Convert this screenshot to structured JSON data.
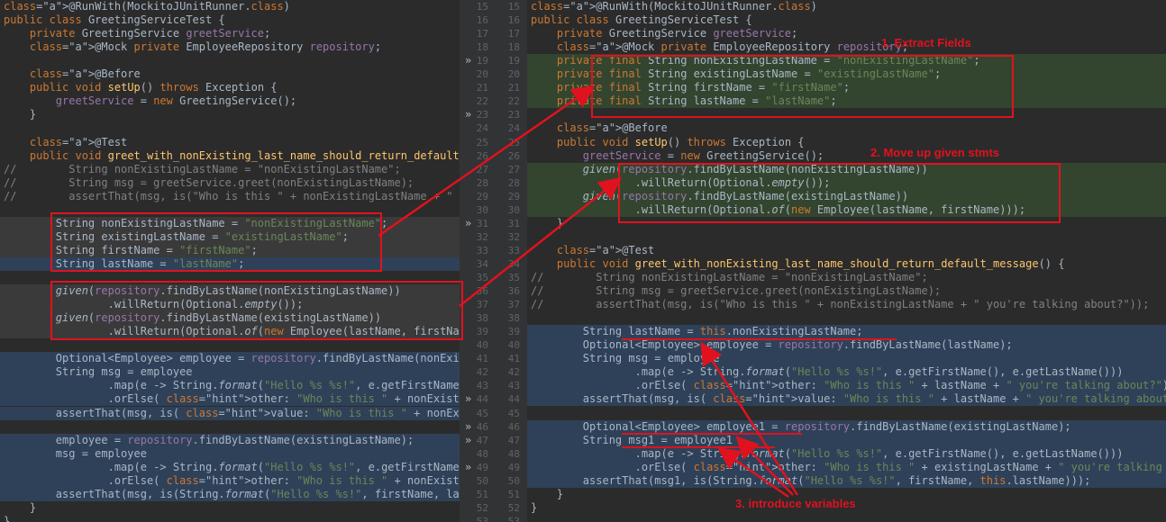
{
  "left_code": [
    "@RunWith(MockitoJUnitRunner.class)",
    "public class GreetingServiceTest {",
    "    private GreetingService greetService;",
    "    @Mock private EmployeeRepository repository;",
    "",
    "    @Before",
    "    public void setUp() throws Exception {",
    "        greetService = new GreetingService();",
    "    }",
    "",
    "    @Test",
    "    public void greet_with_nonExisting_last_name_should_return_default_m",
    "//        String nonExistingLastName = \"nonExistingLastName\";",
    "//        String msg = greetService.greet(nonExistingLastName);",
    "//        assertThat(msg, is(\"Who is this \" + nonExistingLastName + \" yo",
    "",
    "        String nonExistingLastName = \"nonExistingLastName\";",
    "        String existingLastName = \"existingLastName\";",
    "        String firstName = \"firstName\";",
    "        String lastName = \"lastName\";",
    "",
    "        given(repository.findByLastName(nonExistingLastName))",
    "                .willReturn(Optional.empty());",
    "        given(repository.findByLastName(existingLastName))",
    "                .willReturn(Optional.of(new Employee(lastName, firstName",
    "",
    "        Optional<Employee> employee = repository.findByLastName(nonExist",
    "        String msg = employee",
    "                .map(e -> String.format(\"Hello %s %s!\", e.getFirstName()",
    "                .orElse( other: \"Who is this \" + nonExistingLastName + \" y",
    "        assertThat(msg, is( value: \"Who is this \" + nonExistingLastName + \" y",
    "",
    "        employee = repository.findByLastName(existingLastName);",
    "        msg = employee",
    "                .map(e -> String.format(\"Hello %s %s!\", e.getFirstName()",
    "                .orElse( other: \"Who is this \" + nonExistingLastName + \" y",
    "        assertThat(msg, is(String.format(\"Hello %s %s!\", firstName, last",
    "    }",
    "}"
  ],
  "left_numbers": [
    "15",
    "16",
    "17",
    "18",
    "19",
    "20",
    "21",
    "22",
    "23",
    "24",
    "25",
    "26",
    "27",
    "28",
    "29",
    "30",
    "31",
    "32",
    "33",
    "34",
    "35",
    "36",
    "37",
    "38",
    "39",
    "40",
    "41",
    "42",
    "43",
    "44",
    "45",
    "46",
    "47",
    "48",
    "49",
    "50",
    "51",
    "52",
    "53"
  ],
  "right_numbers": [
    "15",
    "16",
    "17",
    "18",
    "19",
    "20",
    "21",
    "22",
    "23",
    "24",
    "25",
    "26",
    "27",
    "28",
    "29",
    "30",
    "31",
    "32",
    "33",
    "34",
    "35",
    "36",
    "37",
    "38",
    "39",
    "40",
    "41",
    "42",
    "43",
    "44",
    "45",
    "46",
    "47",
    "48",
    "49",
    "50",
    "51",
    "52",
    "53"
  ],
  "right_code": [
    "@RunWith(MockitoJUnitRunner.class)",
    "public class GreetingServiceTest {",
    "    private GreetingService greetService;",
    "    @Mock private EmployeeRepository repository;",
    "    private final String nonExistingLastName = \"nonExistingLastName\";",
    "    private final String existingLastName = \"existingLastName\";",
    "    private final String firstName = \"firstName\";",
    "    private final String lastName = \"lastName\";",
    "",
    "    @Before",
    "    public void setUp() throws Exception {",
    "        greetService = new GreetingService();",
    "        given(repository.findByLastName(nonExistingLastName))",
    "                .willReturn(Optional.empty());",
    "        given(repository.findByLastName(existingLastName))",
    "                .willReturn(Optional.of(new Employee(lastName, firstName)));",
    "    }",
    "",
    "    @Test",
    "    public void greet_with_nonExisting_last_name_should_return_default_message() {",
    "//        String nonExistingLastName = \"nonExistingLastName\";",
    "//        String msg = greetService.greet(nonExistingLastName);",
    "//        assertThat(msg, is(\"Who is this \" + nonExistingLastName + \" you're talking about?\"));",
    "",
    "        String lastName = this.nonExistingLastName;",
    "        Optional<Employee> employee = repository.findByLastName(lastName);",
    "        String msg = employee",
    "                .map(e -> String.format(\"Hello %s %s!\", e.getFirstName(), e.getLastName()))",
    "                .orElse( other: \"Who is this \" + lastName + \" you're talking about?\");",
    "        assertThat(msg, is( value: \"Who is this \" + lastName + \" you're talking about?\"));",
    "",
    "        Optional<Employee> employee1 = repository.findByLastName(existingLastName);",
    "        String msg1 = employee1",
    "                .map(e -> String.format(\"Hello %s %s!\", e.getFirstName(), e.getLastName()))",
    "                .orElse( other: \"Who is this \" + existingLastName + \" you're talking about?\");",
    "        assertThat(msg1, is(String.format(\"Hello %s %s!\", firstName, this.lastName)));",
    "    }",
    "}",
    ""
  ],
  "annotations": {
    "extract_fields": "1. Extract Fields",
    "move_up": "2. Move up given stmts",
    "introduce_vars": "3. introduce variables"
  },
  "colors": {
    "annotation": "#e0121e",
    "keyword": "#cc7832",
    "string": "#6a8759",
    "field": "#9876aa"
  }
}
